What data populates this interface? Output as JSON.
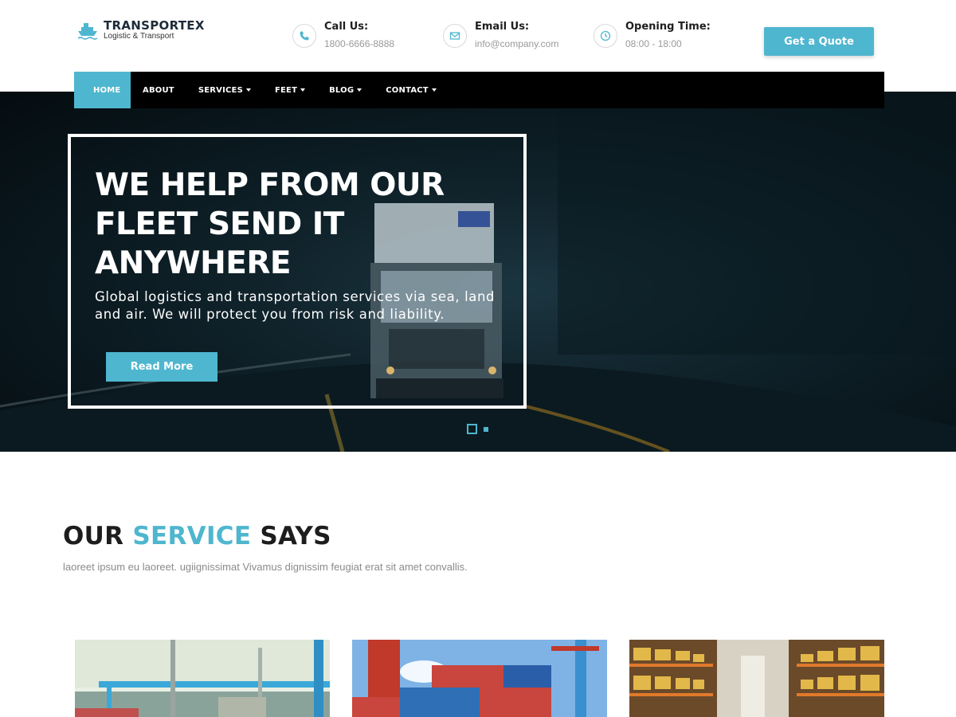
{
  "brand": {
    "name": "TRANSPORTEX",
    "tagline": "Logistic & Transport"
  },
  "contacts": [
    {
      "label": "Call Us:",
      "value": "1800-6666-8888",
      "icon": "phone-icon"
    },
    {
      "label": "Email Us:",
      "value": "info@company.com",
      "icon": "envelope-icon"
    },
    {
      "label": "Opening Time:",
      "value": "08:00 - 18:00",
      "icon": "clock-icon"
    }
  ],
  "header": {
    "quote_label": "Get a Quote"
  },
  "nav": {
    "items": [
      {
        "label": "HOME",
        "active": true
      },
      {
        "label": "ABOUT"
      },
      {
        "label": "SERVICES"
      },
      {
        "label": "FEET"
      },
      {
        "label": "BLOG"
      },
      {
        "label": "CONTACT"
      }
    ]
  },
  "hero": {
    "title": "WE HELP FROM OUR FLEET SEND IT ANYWHERE",
    "text": "Global logistics and transportation services via sea, land and air. We will protect you from risk and liability.",
    "button_label": "Read More",
    "slides_total": 2,
    "active_slide": 1
  },
  "services": {
    "title_part1": "OUR",
    "title_accent": "SERVICE",
    "title_part2": "SAYS",
    "subtitle": "laoreet ipsum eu laoreet. ugiignissimat Vivamus dignissim feugiat erat sit amet convallis.",
    "cards": [
      {
        "image": "port-crane-photo"
      },
      {
        "image": "shipping-containers-photo"
      },
      {
        "image": "warehouse-shelves-photo"
      }
    ]
  },
  "colors": {
    "accent": "#4fb6cf",
    "nav_bg": "#000000",
    "heading": "#1d1d1d"
  }
}
